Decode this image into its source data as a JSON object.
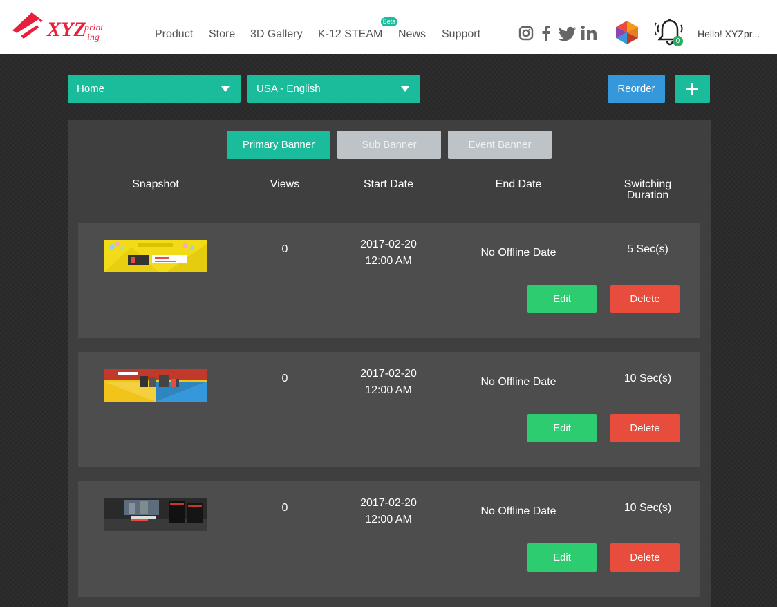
{
  "header": {
    "logo_text": "XYZprinting",
    "nav": [
      "Product",
      "Store",
      "3D Gallery",
      "K-12 STEAM",
      "News",
      "Support"
    ],
    "beta_badge": "Beta",
    "notification_count": "0",
    "greeting": "Hello! XYZpr..."
  },
  "toolbar": {
    "page_select": "Home",
    "language_select": "USA - English",
    "reorder_label": "Reorder"
  },
  "tabs": [
    {
      "label": "Primary Banner",
      "active": true
    },
    {
      "label": "Sub Banner",
      "active": false
    },
    {
      "label": "Event Banner",
      "active": false
    }
  ],
  "columns": {
    "snapshot": "Snapshot",
    "views": "Views",
    "start_date": "Start Date",
    "end_date": "End Date",
    "duration_line1": "Switching",
    "duration_line2": "Duration"
  },
  "banners": [
    {
      "views": "0",
      "start_date": "2017-02-20",
      "start_time": "12:00 AM",
      "end_date": "No Offline Date",
      "duration": "5 Sec(s)",
      "edit": "Edit",
      "delete": "Delete"
    },
    {
      "views": "0",
      "start_date": "2017-02-20",
      "start_time": "12:00 AM",
      "end_date": "No Offline Date",
      "duration": "10 Sec(s)",
      "edit": "Edit",
      "delete": "Delete"
    },
    {
      "views": "0",
      "start_date": "2017-02-20",
      "start_time": "12:00 AM",
      "end_date": "No Offline Date",
      "duration": "10 Sec(s)",
      "edit": "Edit",
      "delete": "Delete"
    }
  ],
  "colors": {
    "accent": "#1abc9c",
    "reorder": "#3498db",
    "edit": "#2ecc71",
    "delete": "#e74c3c",
    "logo": "#e8203b"
  },
  "icons": [
    "instagram-icon",
    "facebook-icon",
    "twitter-icon",
    "linkedin-icon",
    "cube-gem-icon",
    "bell-icon",
    "caret-down-icon",
    "plus-icon"
  ]
}
